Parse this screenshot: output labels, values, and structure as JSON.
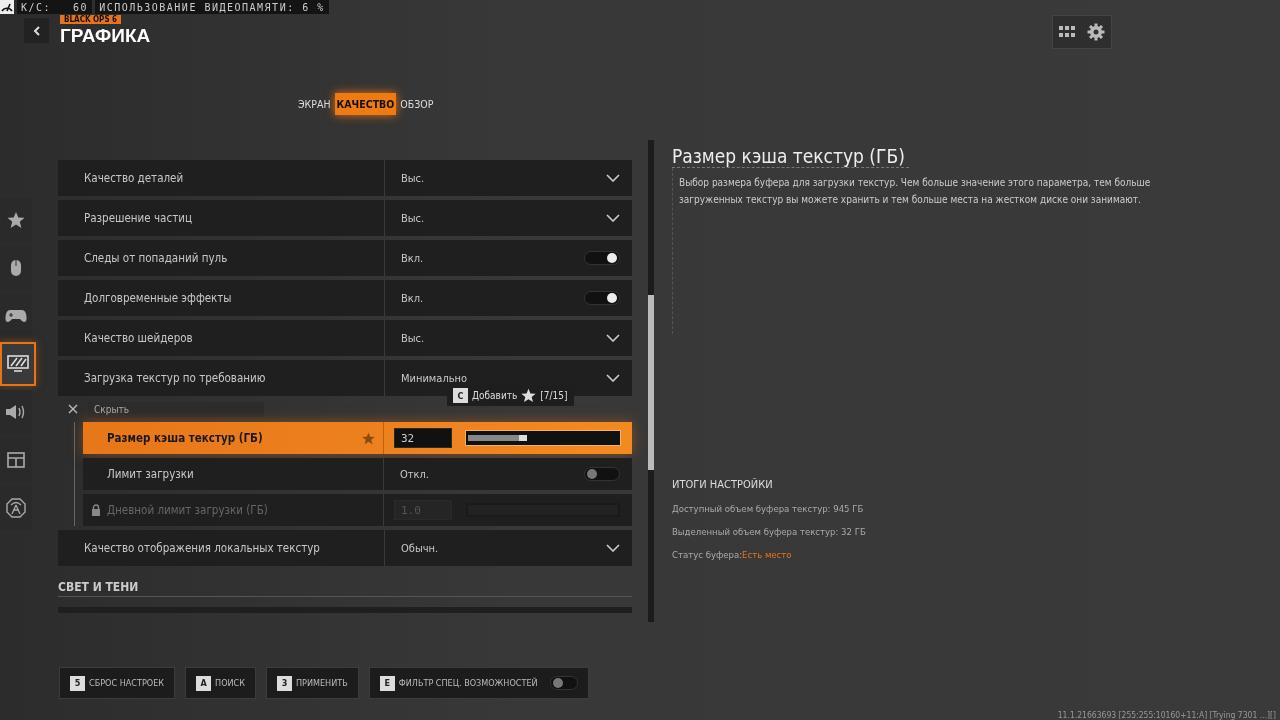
{
  "overlay": {
    "fps_label": "К/С:",
    "fps": "60",
    "vram": "ИСПОЛЬЗОВАНИЕ ВИДЕОПАМЯТИ: 6 %"
  },
  "header": {
    "logo": "BLACK OPS 6",
    "title": "ГРАФИКА"
  },
  "tabs": [
    {
      "label": "ЭКРАН",
      "selected": false
    },
    {
      "label": "КАЧЕСТВО",
      "selected": true
    },
    {
      "label": "ОБЗОР",
      "selected": false
    }
  ],
  "sidebar": {
    "items": [
      {
        "kind": "star",
        "selected": false
      },
      {
        "kind": "mouse",
        "selected": false
      },
      {
        "kind": "gamepad",
        "selected": false
      },
      {
        "kind": "monitor",
        "selected": true
      },
      {
        "kind": "speaker",
        "selected": false
      },
      {
        "kind": "layout",
        "selected": false
      },
      {
        "kind": "network",
        "selected": false
      }
    ]
  },
  "settings": [
    {
      "label": "Качество деталей",
      "kind": "dropdown",
      "value": "Выс."
    },
    {
      "label": "Разрешение частиц",
      "kind": "dropdown",
      "value": "Выс."
    },
    {
      "label": "Следы от попаданий пуль",
      "kind": "toggle",
      "value": "Вкл.",
      "on": true
    },
    {
      "label": "Долговременные эффекты",
      "kind": "toggle",
      "value": "Вкл.",
      "on": true
    },
    {
      "label": "Качество шейдеров",
      "kind": "dropdown",
      "value": "Выс."
    },
    {
      "label": "Загрузка текстур по требованию",
      "kind": "dropdown",
      "value": "Минимально",
      "hide_label": "Скрыть",
      "children": [
        {
          "label": "Размер кэша текстур (ГБ)",
          "kind": "slider",
          "value": "32",
          "level": 0.34,
          "selected": true,
          "favorite": true,
          "disabled": false
        },
        {
          "label": "Лимит загрузки",
          "kind": "toggle",
          "value": "Откл.",
          "on": false,
          "selected": false,
          "disabled": false
        },
        {
          "label": "Дневной лимит загрузки (ГБ)",
          "kind": "slider",
          "value": "1.0",
          "selected": false,
          "disabled": true
        }
      ]
    },
    {
      "label": "Качество отображения локальных текстур",
      "kind": "dropdown",
      "value": "Обычн."
    }
  ],
  "section": "СВЕТ И ТЕНИ",
  "tooltip": {
    "key": "C",
    "label": "Добавить",
    "count": "[7/15]"
  },
  "details": {
    "title": "Размер кэша текстур (ГБ)",
    "description": "Выбор размера буфера для загрузки текстур. Чем больше значение этого параметра, тем больше загруженных текстур вы можете хранить и тем больше места на жестком диске они занимают.",
    "summary_title": "ИТОГИ НАСТРОЙКИ",
    "summary": [
      {
        "text": "Доступный объем буфера текстур: 945 ГБ"
      },
      {
        "text": "Выделенный объем буфера текстур: 32 ГБ"
      },
      {
        "text": "Статус буфера:",
        "highlight": "Есть место"
      }
    ]
  },
  "footer": [
    {
      "key": "5",
      "label": "СБРОС НАСТРОЕК",
      "kind": "button"
    },
    {
      "key": "A",
      "label": "ПОИСК",
      "kind": "button"
    },
    {
      "key": "3",
      "label": "ПРИМЕНИТЬ",
      "kind": "button"
    },
    {
      "key": "E",
      "label": "ФИЛЬТР СПЕЦ. ВОЗМОЖНОСТЕЙ",
      "kind": "toggle",
      "on": false
    }
  ],
  "version": "11.1.21663693 [255:255:10160+11:A] [Trying 7301 ...][]"
}
